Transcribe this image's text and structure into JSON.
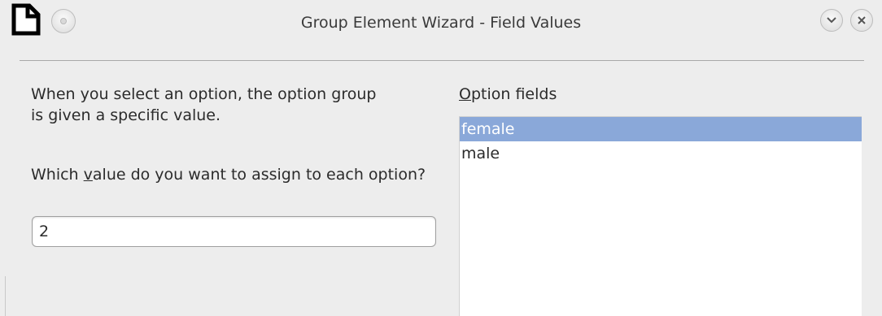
{
  "window": {
    "title": "Group Element Wizard - Field Values"
  },
  "titlebar": {
    "icons": [
      "document-icon",
      "window-menu-icon",
      "shade-icon",
      "close-icon"
    ]
  },
  "instructions": {
    "text": "When you select an option, the option group\nis given a specific value."
  },
  "question": {
    "prefix": "Which ",
    "accel": "v",
    "suffix": "alue do you want to assign to each option?"
  },
  "value_field": {
    "value": "2"
  },
  "options_list": {
    "label_accel": "O",
    "label_rest": "ption fields",
    "items": [
      {
        "label": "female",
        "selected": true
      },
      {
        "label": "male",
        "selected": false
      }
    ],
    "selection_color": "#8aa8d9"
  }
}
